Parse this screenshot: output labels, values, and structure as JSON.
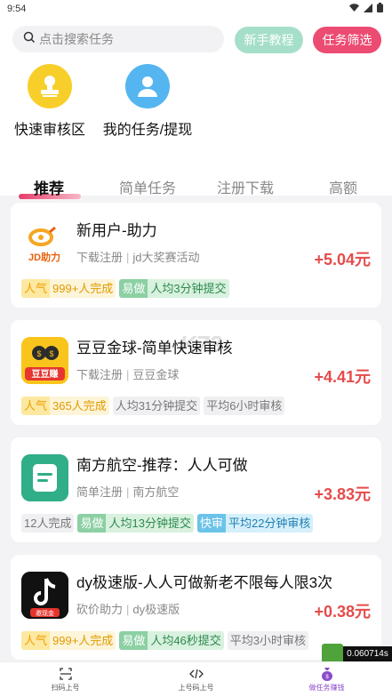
{
  "status_bar": {
    "time": "9:54"
  },
  "search": {
    "placeholder": "点击搜索任务"
  },
  "header_buttons": {
    "tutorial": "新手教程",
    "filter": "任务筛选"
  },
  "entries": [
    {
      "label": "快速审核区"
    },
    {
      "label": "我的任务/提现"
    }
  ],
  "tabs": [
    "推荐",
    "简单任务",
    "注册下载",
    "高额"
  ],
  "tasks": [
    {
      "logo_text": "JD助力",
      "title": "新用户-助力",
      "category": "下载注册",
      "project": "jd大奖赛活动",
      "reward": "+5.04元",
      "tags": [
        {
          "type": "pop",
          "key": "人气",
          "value": "999+人完成"
        },
        {
          "type": "easy",
          "key": "易做",
          "value": "人均3分钟提交"
        }
      ]
    },
    {
      "logo_text": "豆豆赚",
      "title": "豆豆金球-简单快速审核",
      "category": "下载注册",
      "project": "豆豆金球",
      "reward": "+4.41元",
      "tags": [
        {
          "type": "pop",
          "key": "人气",
          "value": "365人完成"
        },
        {
          "type": "plain",
          "key": "",
          "value": "人均31分钟提交"
        },
        {
          "type": "plain",
          "key": "",
          "value": "平均6小时审核"
        }
      ]
    },
    {
      "logo_text": "",
      "title": "南方航空-推荐：人人可做",
      "category": "简单注册",
      "project": "南方航空",
      "reward": "+3.83元",
      "tags": [
        {
          "type": "plain",
          "key": "",
          "value": "12人完成"
        },
        {
          "type": "easy",
          "key": "易做",
          "value": "人均13分钟提交"
        },
        {
          "type": "fast",
          "key": "快审",
          "value": "平均22分钟审核"
        }
      ]
    },
    {
      "logo_text": "邀现金",
      "title": "dy极速版-人人可做新老不限每人限3次",
      "category": "砍价助力",
      "project": "dy极速版",
      "reward": "+0.38元",
      "tags": [
        {
          "type": "pop",
          "key": "人气",
          "value": "999+人完成"
        },
        {
          "type": "easy",
          "key": "易做",
          "value": "人均46秒提交"
        },
        {
          "type": "plain",
          "key": "",
          "value": "平均3小时审核"
        }
      ]
    }
  ],
  "watermark": "K73",
  "bottom_nav": [
    {
      "label": "扫码上号"
    },
    {
      "label": "上号码上号"
    },
    {
      "label": "做任务赚钱"
    }
  ],
  "fps_readout": "0.060714s",
  "colors": {
    "accent": "#ec4b72",
    "reward": "#e54b4b",
    "nav_active": "#8a4cc9"
  }
}
